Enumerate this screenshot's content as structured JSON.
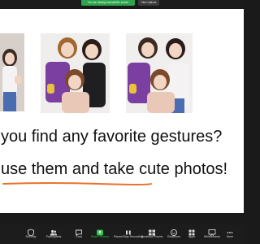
{
  "meeting": {
    "share_banner": "You are viewing Hannah95's screen",
    "view_options": "View Options"
  },
  "slide": {
    "question": "you find any favorite gestures?",
    "invite": "use them and take cute photos!",
    "underline_color": "#e8722c"
  },
  "toolbar": {
    "items": [
      {
        "label": "Security",
        "icon": "shield-icon"
      },
      {
        "label": "Participants",
        "icon": "participants-icon",
        "count": "20"
      },
      {
        "label": "Chat",
        "icon": "chat-icon"
      },
      {
        "label": "Share Screen",
        "icon": "share-screen-icon",
        "color": "#2fbf4a"
      },
      {
        "label": "Pause/Stop Recording",
        "icon": "recording-icon"
      },
      {
        "label": "Breakout Rooms",
        "icon": "breakout-rooms-icon"
      },
      {
        "label": "Reactions",
        "icon": "reactions-icon"
      },
      {
        "label": "Apps",
        "icon": "apps-icon"
      },
      {
        "label": "Whiteboards",
        "icon": "whiteboard-icon"
      },
      {
        "label": "More",
        "icon": "more-icon"
      }
    ]
  }
}
